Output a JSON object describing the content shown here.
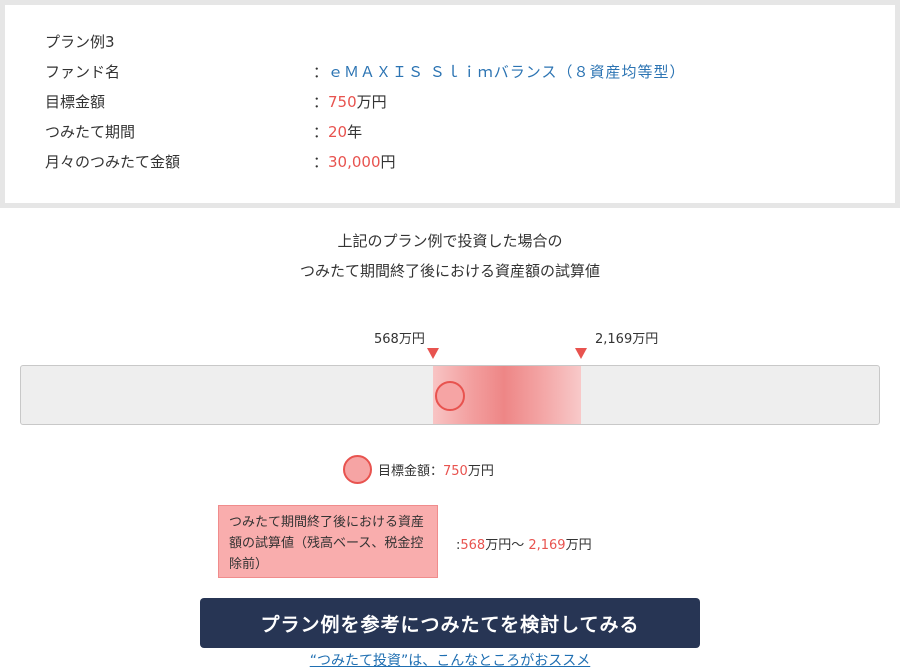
{
  "plan": {
    "title": "プラン例3",
    "rows": [
      {
        "label": "ファンド名",
        "prefix": "：",
        "value": "ｅＭＡＸＩＳ Ｓｌｉｍバランス（８資産均等型）"
      },
      {
        "label": "目標金額",
        "prefix": "：",
        "number": "750",
        "unit": "万円"
      },
      {
        "label": "つみたて期間",
        "prefix": "：",
        "number": "20",
        "unit": "年"
      },
      {
        "label": "月々のつみたて金額",
        "prefix": "：",
        "number": "30,000",
        "unit": "円"
      }
    ]
  },
  "result": {
    "heading_line1": "上記のプラン例で投資した場合の",
    "heading_line2": "つみたて期間終了後における資産額の試算値",
    "low_label": "568万円",
    "high_label": "2,169万円",
    "range_low": 568,
    "range_high": 2169,
    "target_value": 750
  },
  "legend": {
    "target_label": "目標金額：",
    "target_number": "750",
    "target_unit": "万円",
    "range_box_text": "つみたて期間終了後における資産額の試算値（残高ベース、税金控除前）",
    "range_prefix": ":",
    "range_low_number": "568",
    "range_low_unit": "万円～ ",
    "range_high_number": "2,169",
    "range_high_unit": "万円"
  },
  "cta": {
    "button_label": "プラン例を参考につみたてを検討してみる",
    "link_label": "“つみたて投資”は、こんなところがおススメ"
  },
  "colors": {
    "accent": "#e8534f",
    "fund_link": "#2c74b3",
    "button_bg": "#273554"
  }
}
